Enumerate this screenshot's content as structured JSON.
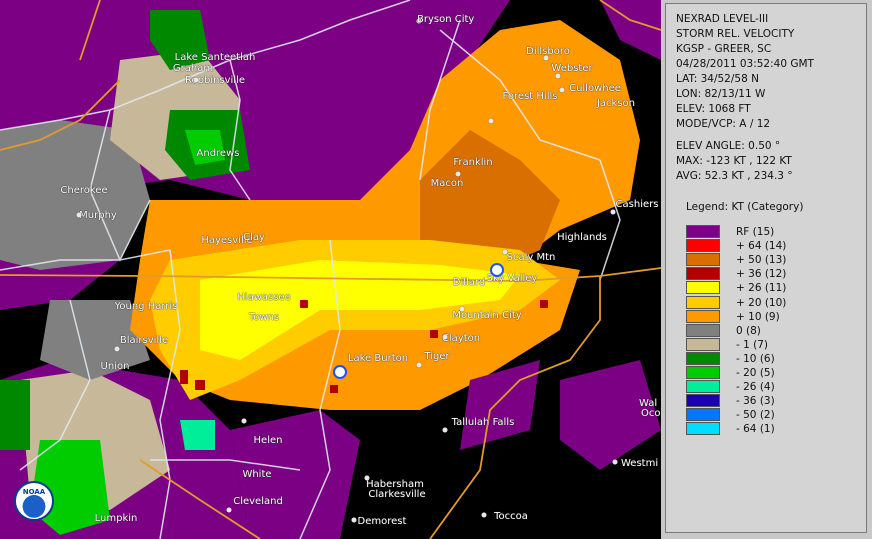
{
  "info": {
    "product": "NEXRAD LEVEL-III",
    "type": "STORM REL. VELOCITY",
    "site": "KGSP - GREER, SC",
    "datetime": "04/28/2011 03:52:40 GMT",
    "lat": "LAT: 34/52/58 N",
    "lon": "LON: 82/13/11 W",
    "elev": "ELEV: 1068 FT",
    "mode": "MODE/VCP: A / 12",
    "elev_angle": "ELEV ANGLE: 0.50 °",
    "max": "MAX: -123 KT , 122 KT",
    "avg": "AVG: 52.3 KT , 234.3 °"
  },
  "legend": {
    "title": "Legend: KT (Category)",
    "items": [
      {
        "label": "RF  (15)",
        "color": "#7b0083"
      },
      {
        "label": "+ 64  (14)",
        "color": "#ff0000"
      },
      {
        "label": "+ 50  (13)",
        "color": "#d96f00"
      },
      {
        "label": "+ 36  (12)",
        "color": "#b00000"
      },
      {
        "label": "+ 26  (11)",
        "color": "#ffff00"
      },
      {
        "label": "+ 20  (10)",
        "color": "#ffcc00"
      },
      {
        "label": "+ 10  (9)",
        "color": "#ff9900"
      },
      {
        "label": "0  (8)",
        "color": "#808080"
      },
      {
        "label": "- 1  (7)",
        "color": "#c8b89a"
      },
      {
        "label": "- 10  (6)",
        "color": "#008800"
      },
      {
        "label": "- 20  (5)",
        "color": "#00cc00"
      },
      {
        "label": "- 26  (4)",
        "color": "#00ee99"
      },
      {
        "label": "- 36  (3)",
        "color": "#1a00b0"
      },
      {
        "label": "- 50  (2)",
        "color": "#0077ff"
      },
      {
        "label": "- 64  (1)",
        "color": "#00ddff"
      }
    ]
  },
  "cities": [
    {
      "name": "Bryson City"
    },
    {
      "name": "Dillsboro"
    },
    {
      "name": "Webster"
    },
    {
      "name": "Lake Santeetlah"
    },
    {
      "name": "Graham"
    },
    {
      "name": "Robbinsville"
    },
    {
      "name": "Forest Hills"
    },
    {
      "name": "Cullowhee"
    },
    {
      "name": "Jackson"
    },
    {
      "name": "Andrews"
    },
    {
      "name": "Franklin"
    },
    {
      "name": "Macon"
    },
    {
      "name": "Cherokee"
    },
    {
      "name": "Murphy"
    },
    {
      "name": "Cashiers"
    },
    {
      "name": "Hayesville"
    },
    {
      "name": "Clay"
    },
    {
      "name": "Highlands"
    },
    {
      "name": "Scaly Mtn"
    },
    {
      "name": "Dillard"
    },
    {
      "name": "Sky Valley"
    },
    {
      "name": "Young Harris"
    },
    {
      "name": "Hiawassee"
    },
    {
      "name": "Towns"
    },
    {
      "name": "Mountain City"
    },
    {
      "name": "Blairsville"
    },
    {
      "name": "Clayton"
    },
    {
      "name": "Union"
    },
    {
      "name": "Lake Burton"
    },
    {
      "name": "Tiger"
    },
    {
      "name": "Tallulah Falls"
    },
    {
      "name": "Helen"
    },
    {
      "name": "White"
    },
    {
      "name": "Habersham"
    },
    {
      "name": "Clarkesville"
    },
    {
      "name": "Cleveland"
    },
    {
      "name": "Lumpkin"
    },
    {
      "name": "Demorest"
    },
    {
      "name": "Toccoa"
    },
    {
      "name": "Westmi"
    },
    {
      "name": "Wal"
    },
    {
      "name": "Oco"
    }
  ],
  "logo": {
    "text": "NOAA"
  }
}
